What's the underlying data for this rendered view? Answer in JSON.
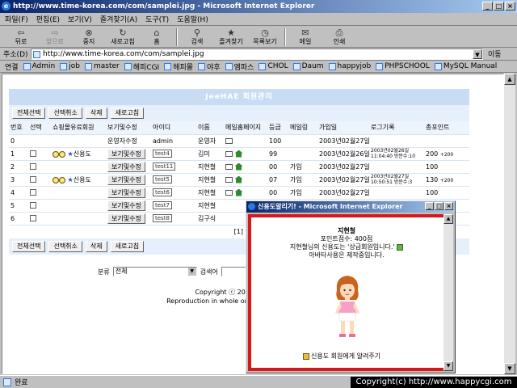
{
  "window": {
    "title": "http://www.time-korea.com/com/samplei.jpg - Microsoft Internet Explorer"
  },
  "menu": [
    "파일(F)",
    "편집(E)",
    "보기(V)",
    "즐겨찾기(A)",
    "도구(T)",
    "도움말(H)"
  ],
  "toolbar": [
    "뒤로",
    "앞으로",
    "중지",
    "새로고침",
    "홈",
    "검색",
    "즐겨찾기",
    "목록보기",
    "메일",
    "인쇄"
  ],
  "address": {
    "label": "주소(D)",
    "url": "http://www.time-korea.com/com/samplei.jpg",
    "go": "이동"
  },
  "links": {
    "label": "연결",
    "items": [
      "Admin",
      "job",
      "master",
      "해피CGI",
      "해피몰",
      "야후",
      "엠파스",
      "CHOL",
      "Daum",
      "happyjob",
      "PHPSCHOOL",
      "MySQL Manual"
    ]
  },
  "board": {
    "heading": "JeeHAE 회원관리",
    "buttons": {
      "select_all": "전체선택",
      "deselect": "선택취소",
      "delete": "삭제",
      "refresh": "새로고침"
    },
    "columns": [
      "번호",
      "선택",
      "쇼핑몰유료회원",
      "보기및수정",
      "아이디",
      "이름",
      "메일홈페이지",
      "등급",
      "메일링",
      "가입일",
      "로그기록",
      "총포인트"
    ],
    "rows": [
      {
        "no": "0",
        "badge": "",
        "view": "운영자수정",
        "id": "admin",
        "name": "운영자",
        "grade": "100",
        "mailing": "",
        "join": "2003년02월27일",
        "log1": "",
        "log2": "",
        "points": "",
        "bonus": "",
        "home": false,
        "mail": false,
        "check": false
      },
      {
        "no": "1",
        "badge": "신용도",
        "view": "보기및수정",
        "id": "test4",
        "name": "김미",
        "grade": "99",
        "mailing": "",
        "join": "2003년02월26일",
        "log1": "2003년02월26일",
        "log2": "11:04:40 방문수:10",
        "points": "200",
        "bonus": "+200",
        "home": true,
        "mail": true,
        "check": true
      },
      {
        "no": "2",
        "badge": "",
        "view": "보기및수정",
        "id": "test11",
        "name": "지현철",
        "grade": "00",
        "mailing": "가입",
        "join": "2003년02월27일",
        "log1": "",
        "log2": "",
        "points": "100",
        "bonus": "",
        "home": true,
        "mail": true,
        "check": true
      },
      {
        "no": "3",
        "badge": "신용도",
        "view": "보기및수정",
        "id": "test5",
        "name": "지현철",
        "grade": "07",
        "mailing": "가입",
        "join": "2003년02월27일",
        "log1": "2003년02월27일",
        "log2": "10:50:51 방문수:3",
        "points": "130",
        "bonus": "+200",
        "home": true,
        "mail": true,
        "check": true
      },
      {
        "no": "4",
        "badge": "",
        "view": "보기및수정",
        "id": "test6",
        "name": "지현철",
        "grade": "00",
        "mailing": "가입",
        "join": "2003년02월27일",
        "log1": "",
        "log2": "",
        "points": "100",
        "bonus": "",
        "home": true,
        "mail": true,
        "check": true
      },
      {
        "no": "5",
        "badge": "",
        "view": "보기및수정",
        "id": "test7",
        "name": "지현철",
        "grade": "",
        "mailing": "",
        "join": "",
        "log1": "",
        "log2": "",
        "points": "",
        "bonus": "",
        "home": false,
        "mail": false,
        "check": true
      },
      {
        "no": "6",
        "badge": "",
        "view": "보기및수정",
        "id": "test8",
        "name": "김구식",
        "grade": "",
        "mailing": "",
        "join": "",
        "log1": "",
        "log2": "",
        "points": "",
        "bonus": "",
        "home": false,
        "mail": false,
        "check": true
      }
    ],
    "pager": "[1]",
    "search": {
      "label": "분류",
      "category": "전체",
      "keyword_label": "검색어"
    },
    "footer": {
      "line1": "Copyright ⓒ 2002 JeeHae",
      "line2": "Reproduction in whole or in part without pe"
    }
  },
  "popup": {
    "title": "신용도알리기! - Microsoft Internet Explorer",
    "name": "지현철",
    "points": "포인트점수: 400점",
    "credit": "지현철님의 신용도는 '상급회원입니다.'",
    "avatar_note": "아바타사용은 제작중입니다.",
    "alert": "신용도 회원에게 알려주기"
  },
  "status": {
    "text": "완료"
  },
  "copyright": "Copyright(c) http://www.happycgi.com"
}
